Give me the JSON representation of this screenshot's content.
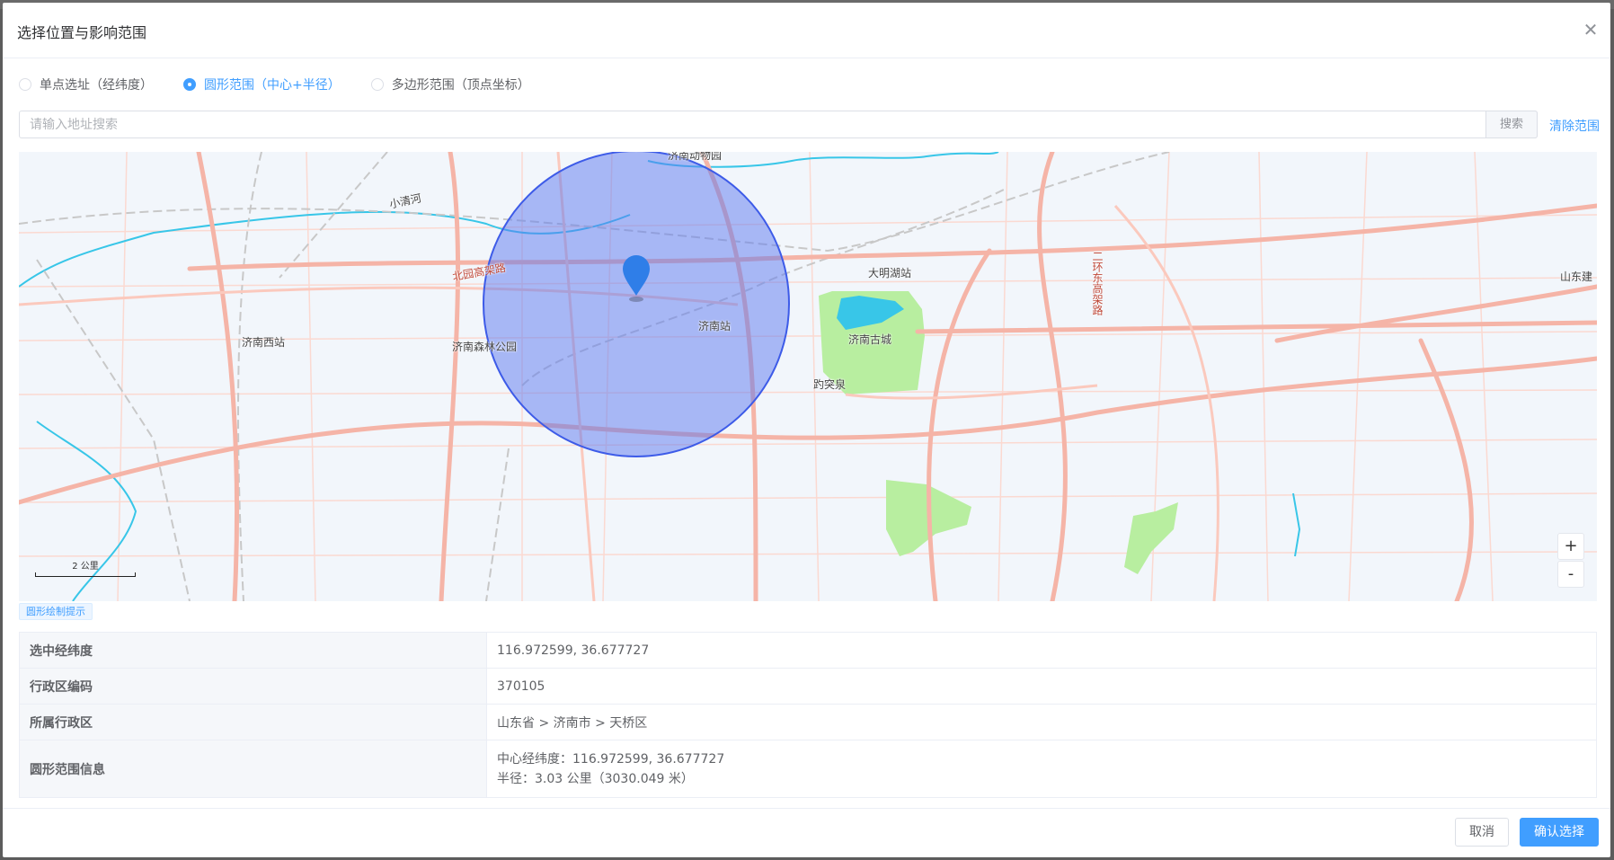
{
  "dialog": {
    "title": "选择位置与影响范围",
    "close_icon": "close-icon"
  },
  "mode_options": [
    {
      "label": "单点选址（经纬度）",
      "checked": false
    },
    {
      "label": "圆形范围（中心+半径）",
      "checked": true
    },
    {
      "label": "多边形范围（顶点坐标）",
      "checked": false
    }
  ],
  "search": {
    "placeholder": "请输入地址搜索",
    "value": "",
    "button_label": "搜索",
    "clear_label": "清除范围"
  },
  "map": {
    "labels": {
      "xiaoqinghe": "小清河",
      "jinan_west": "济南西站",
      "forest_park": "济南森林公园",
      "jinan_station": "济南站",
      "daming_lake_station": "大明湖站",
      "old_city": "济南古城",
      "baotu_spring": "趵突泉",
      "zoo": "济南动物园",
      "north_elevated": "北园高架路",
      "east_elevated": "二环东高架路",
      "shandong_jian": "山东建"
    },
    "scale_label": "2 公里",
    "zoom_in_label": "+",
    "zoom_out_label": "-",
    "circle_color": "#5b77f0",
    "marker_color": "#2f7ee8"
  },
  "hint_tag": "圆形绘制提示",
  "info": {
    "rows": [
      {
        "label": "选中经纬度",
        "value": "116.972599, 36.677727"
      },
      {
        "label": "行政区编码",
        "value": "370105"
      },
      {
        "label": "所属行政区",
        "value": "山东省 > 济南市 > 天桥区"
      }
    ],
    "circle_label": "圆形范围信息",
    "circle_center": "中心经纬度：116.972599, 36.677727",
    "circle_radius": "半径：3.03 公里（3030.049 米）"
  },
  "footer": {
    "cancel_label": "取消",
    "confirm_label": "确认选择"
  },
  "colors": {
    "primary": "#409eff",
    "map_background": "#f2f6fb",
    "road_major": "#f5b4a7",
    "water": "#38c6e8",
    "park": "#b8eea0"
  }
}
